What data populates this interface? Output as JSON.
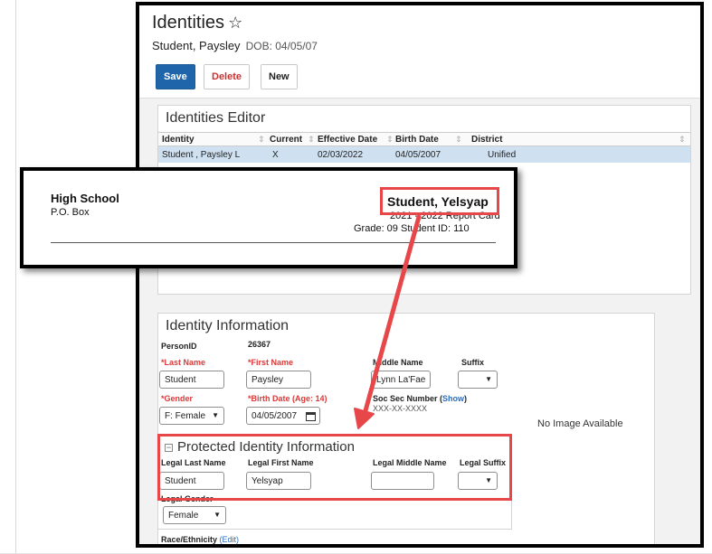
{
  "header": {
    "title": "Identities",
    "star": "☆",
    "student_name": "Student, Paysley",
    "dob": "DOB: 04/05/07"
  },
  "toolbar": {
    "save_label": "Save",
    "delete_label": "Delete",
    "new_label": "New"
  },
  "editor": {
    "title": "Identities Editor",
    "columns": [
      "Identity",
      "Current",
      "Effective Date",
      "Birth Date",
      "District"
    ],
    "sort_glyph": "⇕",
    "rows": [
      [
        "Student , Paysley L",
        "X",
        "02/03/2022",
        "04/05/2007",
        "Unified"
      ]
    ]
  },
  "report_card": {
    "school": "High School",
    "address": "P.O. Box",
    "student_name": "Student, Yelsyap",
    "report_title": "2021 - 2022 Report Card",
    "grade_line": "Grade: 09   Student ID: 110"
  },
  "identity_info": {
    "title": "Identity Information",
    "personid_label": "PersonID",
    "personid_value": "26367",
    "last_name_label": "*Last Name",
    "last_name_value": "Student",
    "first_name_label": "*First Name",
    "first_name_value": "Paysley",
    "middle_name_label": "Middle Name",
    "middle_name_value": "Lynn La'Fae",
    "suffix_label": "Suffix",
    "gender_label": "*Gender",
    "gender_value": "F: Female",
    "birth_label": "*Birth Date (Age: 14)",
    "birth_value": "04/05/2007",
    "ssn_label": "Soc Sec Number (",
    "ssn_link": "Show",
    "ssn_close": ")",
    "ssn_value": "XXX-XX-XXXX",
    "no_image": "No Image Available"
  },
  "protected": {
    "title": "Protected Identity Information",
    "legal_last_label": "Legal Last Name",
    "legal_last_value": "Student",
    "legal_first_label": "Legal First Name",
    "legal_first_value": "Yelsyap",
    "legal_middle_label": "Legal Middle Name",
    "legal_suffix_label": "Legal Suffix",
    "legal_gender_label": "Legal Gender",
    "legal_gender_value": "Female"
  },
  "race": {
    "label": "Race/Ethnicity",
    "edit_link": "(Edit)"
  },
  "colors": {
    "save_blue": "#1e66a9",
    "highlight_red": "#e8474a",
    "required_red": "#d93a3a",
    "selected_row": "#cfe0f1",
    "link_blue": "#2a6ebb"
  },
  "caret_glyph": "▼"
}
